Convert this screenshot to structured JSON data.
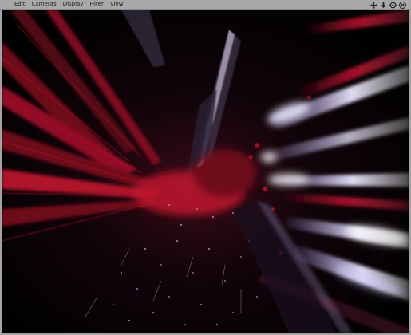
{
  "menubar": {
    "items": [
      "Edit",
      "Cameras",
      "Display",
      "Filter",
      "View"
    ]
  },
  "toolbar": {
    "icons": [
      "move-icon",
      "download-icon",
      "settings-icon",
      "close-icon"
    ]
  },
  "viewport": {
    "accent_colors": [
      "#c0122f",
      "#7a0a1e",
      "#e9e6ff",
      "#b9a9ff"
    ]
  }
}
